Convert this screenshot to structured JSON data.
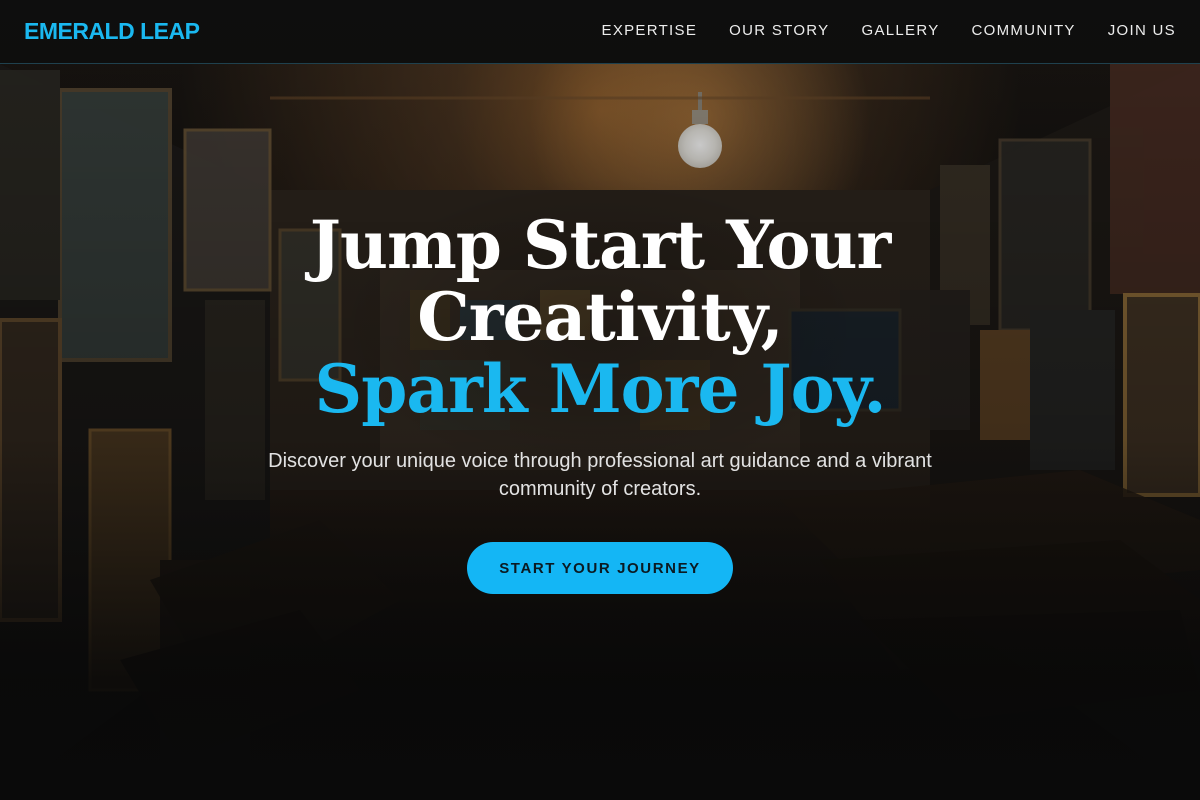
{
  "brand": {
    "name": "EMERALD LEAP",
    "accent_color": "#1ab8f0"
  },
  "nav": {
    "items": [
      {
        "label": "EXPERTISE"
      },
      {
        "label": "OUR STORY"
      },
      {
        "label": "GALLERY"
      },
      {
        "label": "COMMUNITY"
      },
      {
        "label": "JOIN US"
      }
    ]
  },
  "hero": {
    "title_line1": "Jump Start Your",
    "title_line2": "Creativity,",
    "title_accent": "Spark More Joy.",
    "subtitle": "Discover your unique voice through professional art guidance and a vibrant community of creators.",
    "cta_label": "START YOUR JOURNEY",
    "cta_color": "#14b6f5",
    "background": "dark art storage room with stacked paintings and a hanging light bulb"
  }
}
